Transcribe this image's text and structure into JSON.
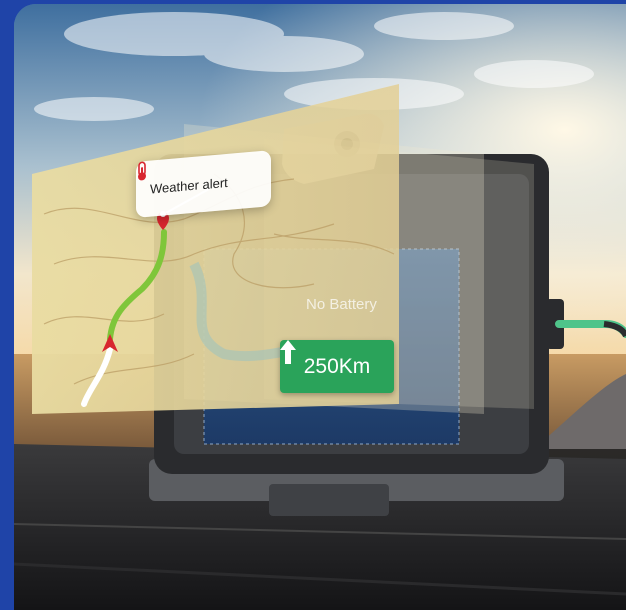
{
  "weather_alert": {
    "label": "Weather alert",
    "icon": "thermometer-icon"
  },
  "status_text": "No Battery",
  "distance": {
    "label": "250Km",
    "icon": "up-arrow-icon"
  },
  "colors": {
    "frame_blue": "#1f44a8",
    "route_green": "#7fc63a",
    "badge_green": "#2aa35a",
    "pin_red": "#d8262f",
    "cable_green": "#4fc48a"
  }
}
